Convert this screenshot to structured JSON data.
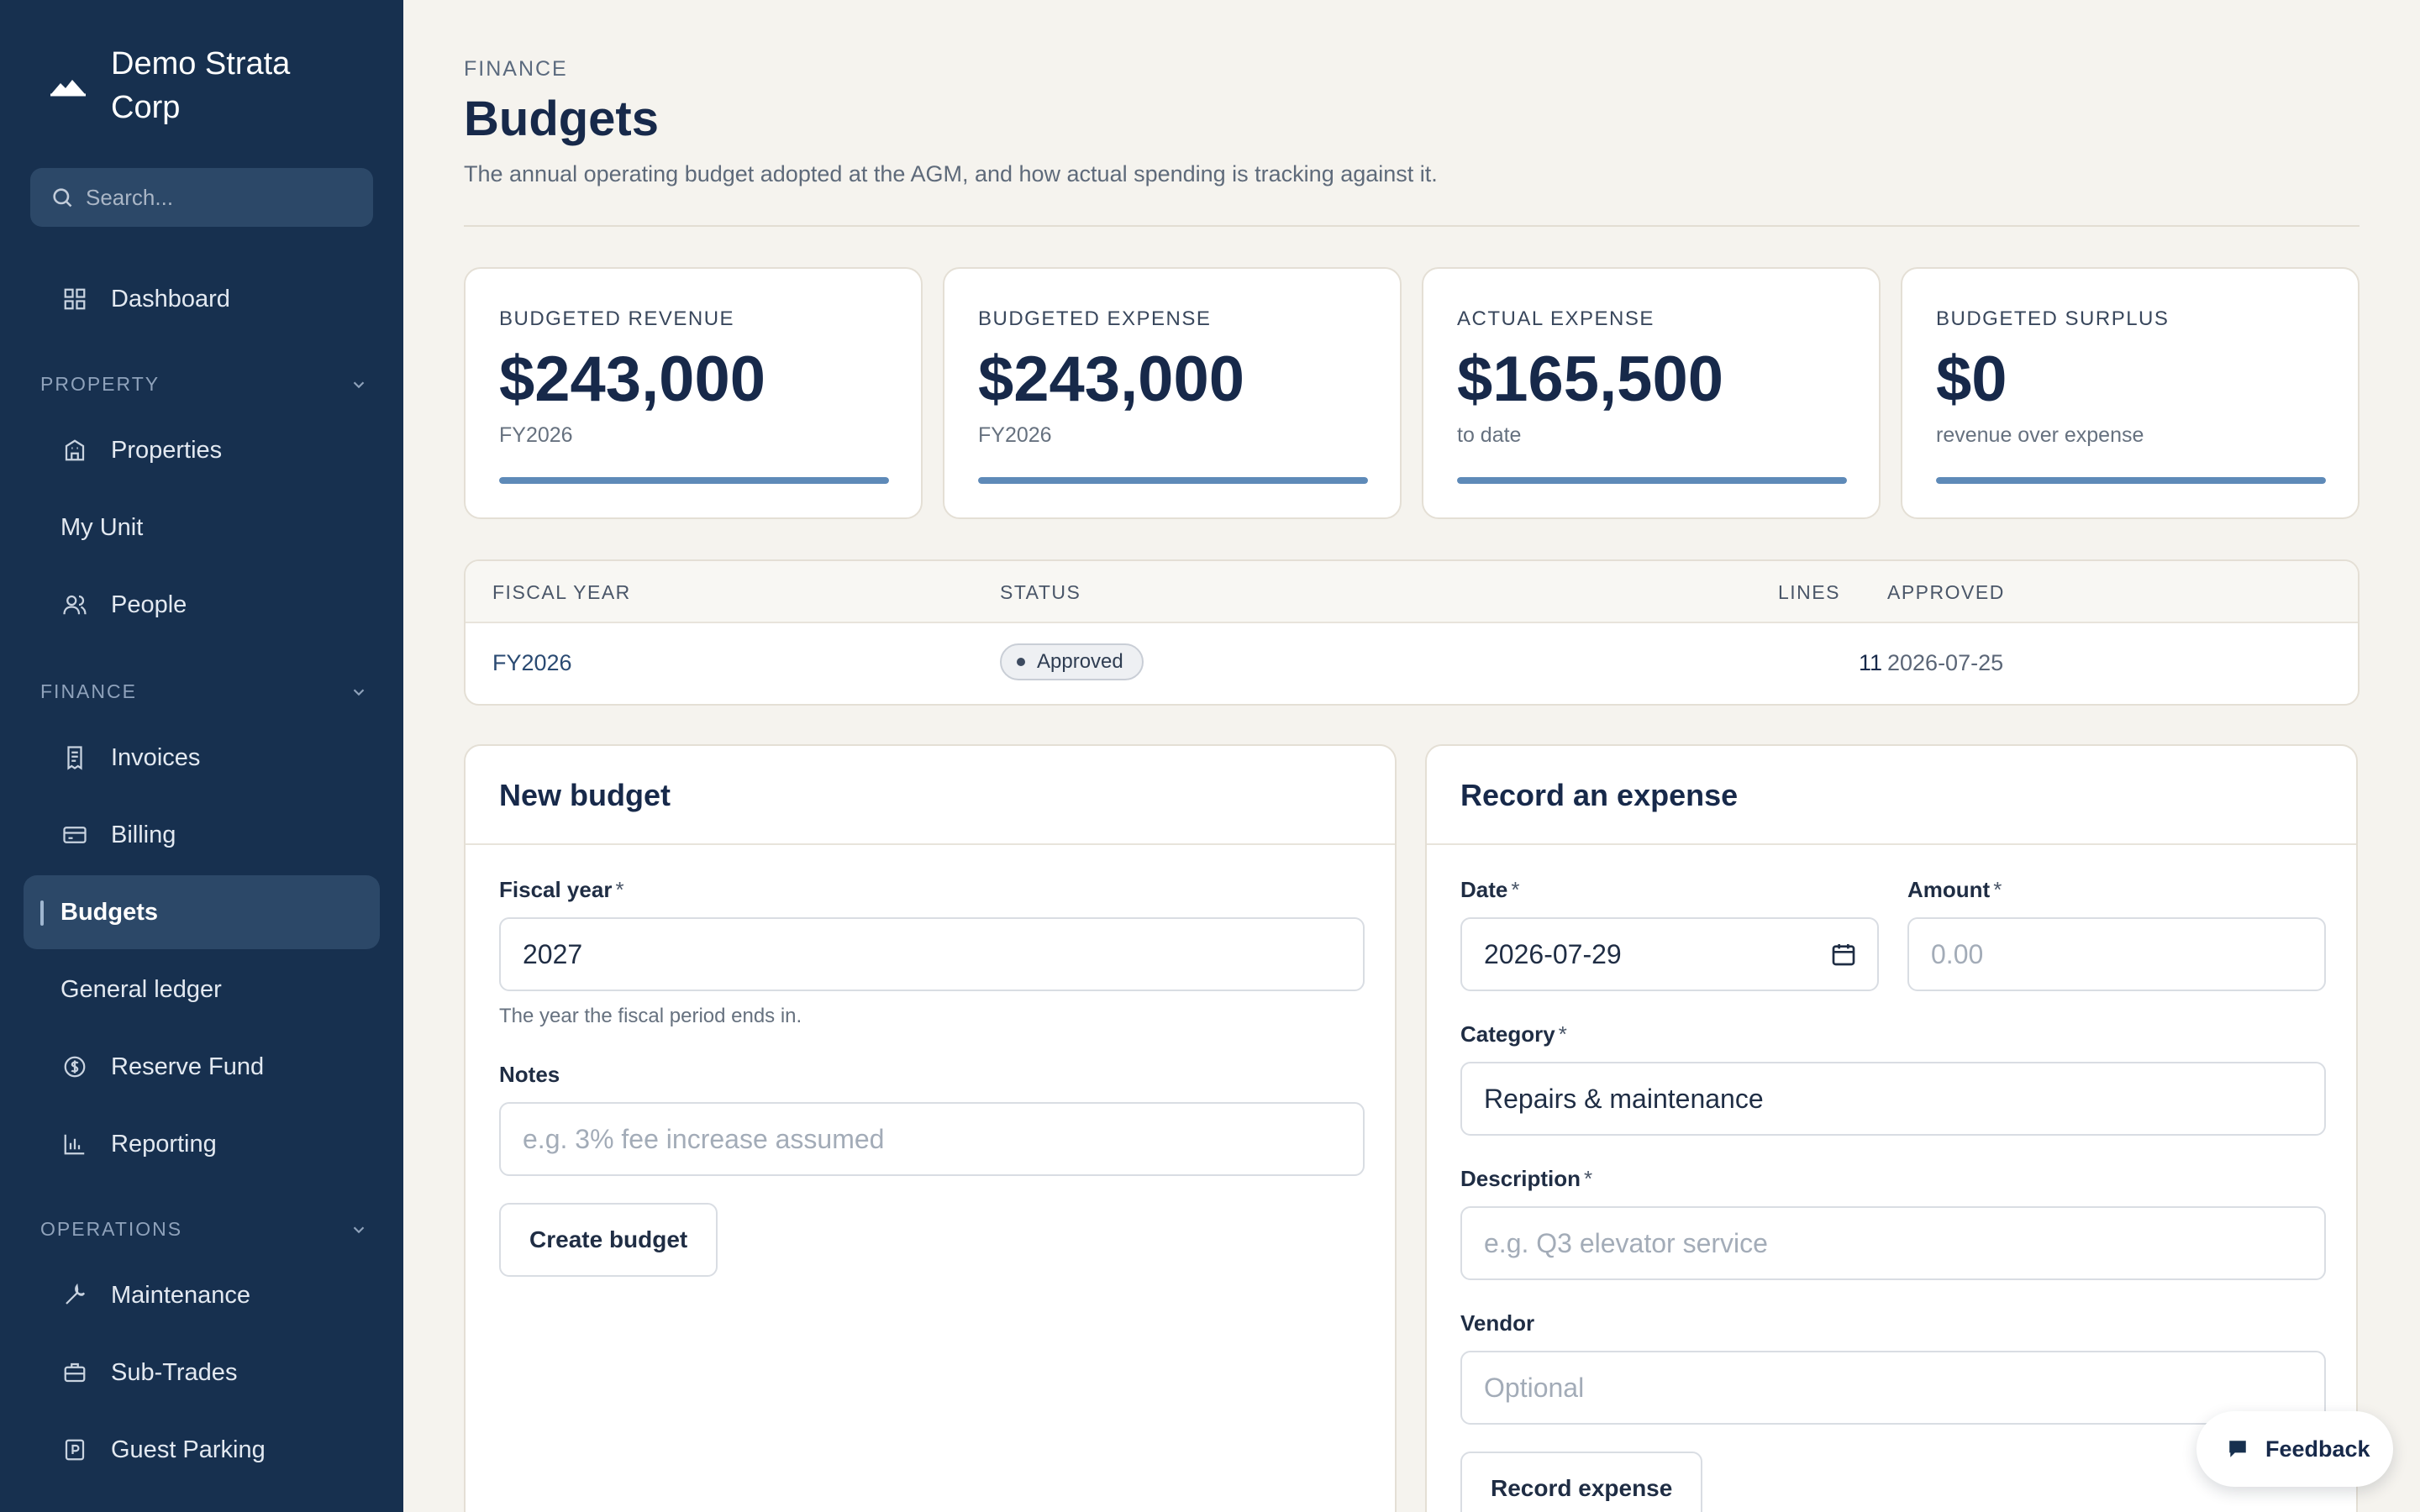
{
  "brand": {
    "name": "Demo Strata Corp",
    "logo_icon": "mountain-icon"
  },
  "search": {
    "placeholder": "Search..."
  },
  "sidebar": {
    "dashboard": {
      "label": "Dashboard",
      "icon": "grid-icon"
    },
    "sections": {
      "property": "PROPERTY",
      "finance": "FINANCE",
      "operations": "OPERATIONS"
    },
    "property_items": [
      {
        "label": "Properties",
        "icon": "building-icon"
      },
      {
        "label": "My Unit"
      },
      {
        "label": "People",
        "icon": "people-icon"
      }
    ],
    "finance_items": [
      {
        "label": "Invoices",
        "icon": "receipt-icon"
      },
      {
        "label": "Billing",
        "icon": "card-icon"
      },
      {
        "label": "Budgets",
        "active": true
      },
      {
        "label": "General ledger"
      },
      {
        "label": "Reserve Fund",
        "icon": "coin-icon"
      },
      {
        "label": "Reporting",
        "icon": "bar-chart-icon"
      }
    ],
    "operations_items": [
      {
        "label": "Maintenance",
        "icon": "wrench-icon"
      },
      {
        "label": "Sub-Trades",
        "icon": "briefcase-icon"
      },
      {
        "label": "Guest Parking",
        "icon": "parking-icon"
      }
    ]
  },
  "page": {
    "eyebrow": "FINANCE",
    "title": "Budgets",
    "subtitle": "The annual operating budget adopted at the AGM, and how actual spending is tracking against it."
  },
  "cards": [
    {
      "label": "BUDGETED REVENUE",
      "value": "$243,000",
      "sub": "FY2026",
      "progress": 1.0
    },
    {
      "label": "BUDGETED EXPENSE",
      "value": "$243,000",
      "sub": "FY2026",
      "progress": 1.0
    },
    {
      "label": "ACTUAL EXPENSE",
      "value": "$165,500",
      "sub": "to date",
      "progress": 1.0
    },
    {
      "label": "BUDGETED SURPLUS",
      "value": "$0",
      "sub": "revenue over expense",
      "progress": 1.0
    }
  ],
  "table": {
    "headers": {
      "fiscal_year": "FISCAL YEAR",
      "status": "STATUS",
      "lines": "LINES",
      "approved": "APPROVED"
    },
    "rows": [
      {
        "fiscal_year": "FY2026",
        "status": "Approved",
        "lines": "11",
        "approved": "2026-07-25"
      }
    ]
  },
  "new_budget": {
    "title": "New budget",
    "fiscal_year_label": "Fiscal year",
    "fiscal_year_value": "2027",
    "fiscal_year_hint": "The year the fiscal period ends in.",
    "notes_label": "Notes",
    "notes_placeholder": "e.g. 3% fee increase assumed",
    "submit": "Create budget",
    "required_mark": "*"
  },
  "expense": {
    "title": "Record an expense",
    "date_label": "Date",
    "date_value": "2026-07-29",
    "amount_label": "Amount",
    "amount_placeholder": "0.00",
    "category_label": "Category",
    "category_value": "Repairs & maintenance",
    "description_label": "Description",
    "description_placeholder": "e.g. Q3 elevator service",
    "vendor_label": "Vendor",
    "vendor_placeholder": "Optional",
    "submit": "Record expense",
    "required_mark": "*"
  },
  "feedback": {
    "label": "Feedback",
    "icon": "chat-icon"
  },
  "colors": {
    "sidebar": "#17304f",
    "accent": "#5e8ab8",
    "background": "#f5f3ee"
  }
}
